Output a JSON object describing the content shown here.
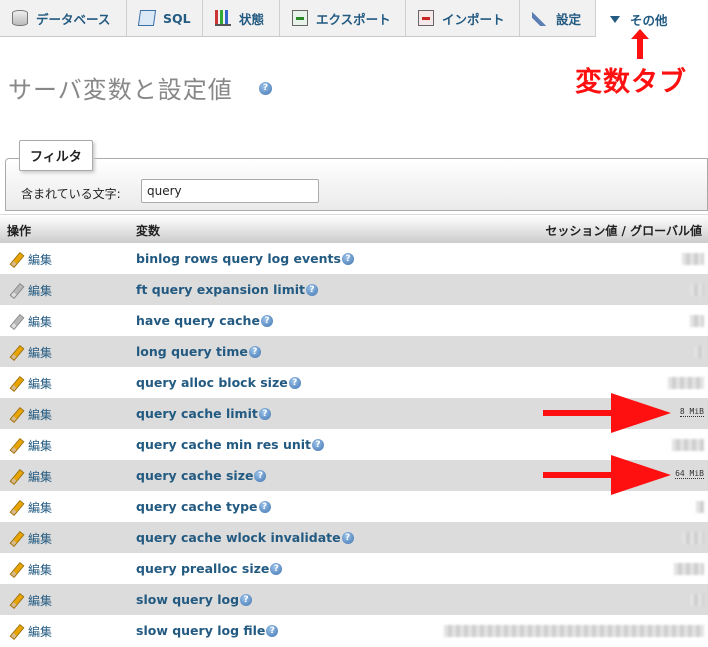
{
  "tabs": [
    {
      "label": "データベース",
      "icon": "database-icon"
    },
    {
      "label": "SQL",
      "icon": "sql-icon"
    },
    {
      "label": "状態",
      "icon": "status-chart-icon"
    },
    {
      "label": "エクスポート",
      "icon": "export-icon"
    },
    {
      "label": "インポート",
      "icon": "import-icon"
    },
    {
      "label": "設定",
      "icon": "wrench-icon"
    },
    {
      "label": "その他",
      "icon": "triangle-down-icon"
    }
  ],
  "page": {
    "title": "サーバ変数と設定値",
    "help_glyph": "?"
  },
  "annotation": {
    "label": "変数タブ",
    "color": "#ff1010"
  },
  "filter": {
    "legend": "フィルタ",
    "label": "含まれている文字:",
    "value": "query"
  },
  "table": {
    "headers": {
      "action": "操作",
      "variable": "変数",
      "value": "セッション値 / グローバル値"
    },
    "edit_label": "編集",
    "rows": [
      {
        "name": "binlog rows query log events",
        "value": "",
        "editable": true
      },
      {
        "name": "ft query expansion limit",
        "value": "",
        "editable": false
      },
      {
        "name": "have query cache",
        "value": "",
        "editable": false
      },
      {
        "name": "long query time",
        "value": "",
        "editable": true
      },
      {
        "name": "query alloc block size",
        "value": "",
        "editable": true
      },
      {
        "name": "query cache limit",
        "value": "8 MiB",
        "editable": true
      },
      {
        "name": "query cache min res unit",
        "value": "",
        "editable": true
      },
      {
        "name": "query cache size",
        "value": "64 MiB",
        "editable": true
      },
      {
        "name": "query cache type",
        "value": "",
        "editable": true
      },
      {
        "name": "query cache wlock invalidate",
        "value": "",
        "editable": true
      },
      {
        "name": "query prealloc size",
        "value": "",
        "editable": true
      },
      {
        "name": "slow query log",
        "value": "",
        "editable": true
      },
      {
        "name": "slow query log file",
        "value": "",
        "editable": true
      }
    ]
  }
}
